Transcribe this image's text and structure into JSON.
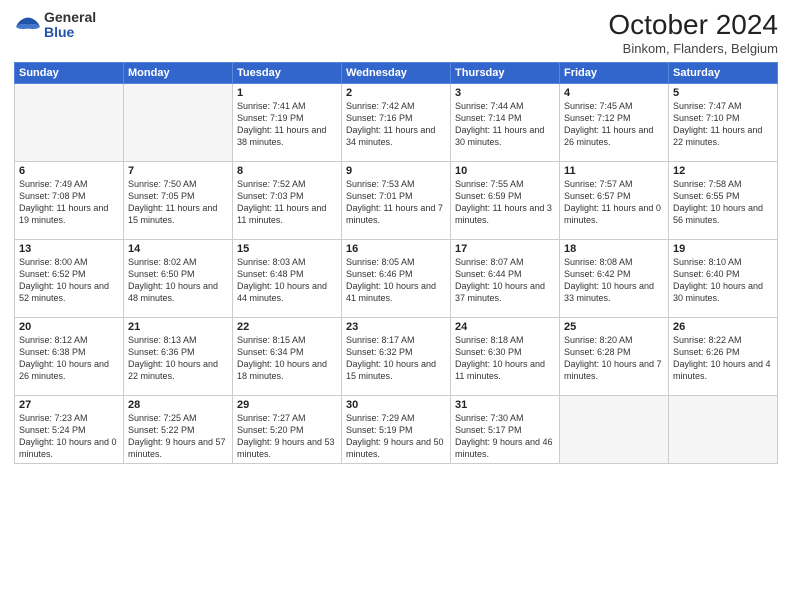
{
  "header": {
    "logo_general": "General",
    "logo_blue": "Blue",
    "month_title": "October 2024",
    "subtitle": "Binkom, Flanders, Belgium"
  },
  "days_of_week": [
    "Sunday",
    "Monday",
    "Tuesday",
    "Wednesday",
    "Thursday",
    "Friday",
    "Saturday"
  ],
  "weeks": [
    [
      {
        "day": "",
        "info": ""
      },
      {
        "day": "",
        "info": ""
      },
      {
        "day": "1",
        "info": "Sunrise: 7:41 AM\nSunset: 7:19 PM\nDaylight: 11 hours and 38 minutes."
      },
      {
        "day": "2",
        "info": "Sunrise: 7:42 AM\nSunset: 7:16 PM\nDaylight: 11 hours and 34 minutes."
      },
      {
        "day": "3",
        "info": "Sunrise: 7:44 AM\nSunset: 7:14 PM\nDaylight: 11 hours and 30 minutes."
      },
      {
        "day": "4",
        "info": "Sunrise: 7:45 AM\nSunset: 7:12 PM\nDaylight: 11 hours and 26 minutes."
      },
      {
        "day": "5",
        "info": "Sunrise: 7:47 AM\nSunset: 7:10 PM\nDaylight: 11 hours and 22 minutes."
      }
    ],
    [
      {
        "day": "6",
        "info": "Sunrise: 7:49 AM\nSunset: 7:08 PM\nDaylight: 11 hours and 19 minutes."
      },
      {
        "day": "7",
        "info": "Sunrise: 7:50 AM\nSunset: 7:05 PM\nDaylight: 11 hours and 15 minutes."
      },
      {
        "day": "8",
        "info": "Sunrise: 7:52 AM\nSunset: 7:03 PM\nDaylight: 11 hours and 11 minutes."
      },
      {
        "day": "9",
        "info": "Sunrise: 7:53 AM\nSunset: 7:01 PM\nDaylight: 11 hours and 7 minutes."
      },
      {
        "day": "10",
        "info": "Sunrise: 7:55 AM\nSunset: 6:59 PM\nDaylight: 11 hours and 3 minutes."
      },
      {
        "day": "11",
        "info": "Sunrise: 7:57 AM\nSunset: 6:57 PM\nDaylight: 11 hours and 0 minutes."
      },
      {
        "day": "12",
        "info": "Sunrise: 7:58 AM\nSunset: 6:55 PM\nDaylight: 10 hours and 56 minutes."
      }
    ],
    [
      {
        "day": "13",
        "info": "Sunrise: 8:00 AM\nSunset: 6:52 PM\nDaylight: 10 hours and 52 minutes."
      },
      {
        "day": "14",
        "info": "Sunrise: 8:02 AM\nSunset: 6:50 PM\nDaylight: 10 hours and 48 minutes."
      },
      {
        "day": "15",
        "info": "Sunrise: 8:03 AM\nSunset: 6:48 PM\nDaylight: 10 hours and 44 minutes."
      },
      {
        "day": "16",
        "info": "Sunrise: 8:05 AM\nSunset: 6:46 PM\nDaylight: 10 hours and 41 minutes."
      },
      {
        "day": "17",
        "info": "Sunrise: 8:07 AM\nSunset: 6:44 PM\nDaylight: 10 hours and 37 minutes."
      },
      {
        "day": "18",
        "info": "Sunrise: 8:08 AM\nSunset: 6:42 PM\nDaylight: 10 hours and 33 minutes."
      },
      {
        "day": "19",
        "info": "Sunrise: 8:10 AM\nSunset: 6:40 PM\nDaylight: 10 hours and 30 minutes."
      }
    ],
    [
      {
        "day": "20",
        "info": "Sunrise: 8:12 AM\nSunset: 6:38 PM\nDaylight: 10 hours and 26 minutes."
      },
      {
        "day": "21",
        "info": "Sunrise: 8:13 AM\nSunset: 6:36 PM\nDaylight: 10 hours and 22 minutes."
      },
      {
        "day": "22",
        "info": "Sunrise: 8:15 AM\nSunset: 6:34 PM\nDaylight: 10 hours and 18 minutes."
      },
      {
        "day": "23",
        "info": "Sunrise: 8:17 AM\nSunset: 6:32 PM\nDaylight: 10 hours and 15 minutes."
      },
      {
        "day": "24",
        "info": "Sunrise: 8:18 AM\nSunset: 6:30 PM\nDaylight: 10 hours and 11 minutes."
      },
      {
        "day": "25",
        "info": "Sunrise: 8:20 AM\nSunset: 6:28 PM\nDaylight: 10 hours and 7 minutes."
      },
      {
        "day": "26",
        "info": "Sunrise: 8:22 AM\nSunset: 6:26 PM\nDaylight: 10 hours and 4 minutes."
      }
    ],
    [
      {
        "day": "27",
        "info": "Sunrise: 7:23 AM\nSunset: 5:24 PM\nDaylight: 10 hours and 0 minutes."
      },
      {
        "day": "28",
        "info": "Sunrise: 7:25 AM\nSunset: 5:22 PM\nDaylight: 9 hours and 57 minutes."
      },
      {
        "day": "29",
        "info": "Sunrise: 7:27 AM\nSunset: 5:20 PM\nDaylight: 9 hours and 53 minutes."
      },
      {
        "day": "30",
        "info": "Sunrise: 7:29 AM\nSunset: 5:19 PM\nDaylight: 9 hours and 50 minutes."
      },
      {
        "day": "31",
        "info": "Sunrise: 7:30 AM\nSunset: 5:17 PM\nDaylight: 9 hours and 46 minutes."
      },
      {
        "day": "",
        "info": ""
      },
      {
        "day": "",
        "info": ""
      }
    ]
  ]
}
